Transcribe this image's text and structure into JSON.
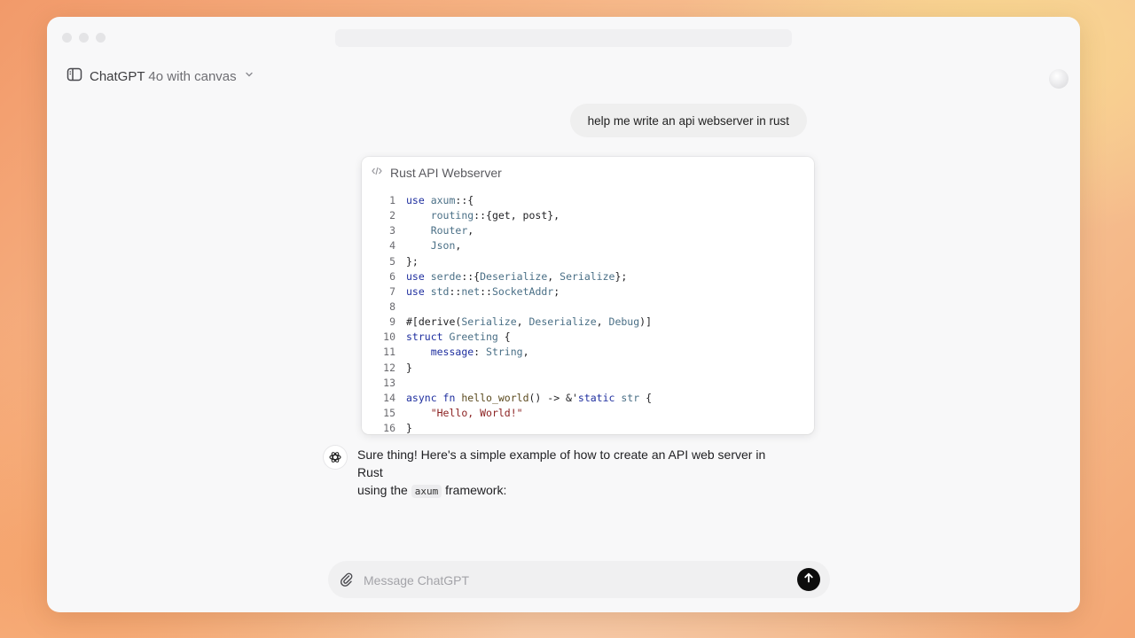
{
  "header": {
    "model_name": "ChatGPT",
    "model_variant": "4o with canvas"
  },
  "conversation": {
    "user_message": "help me write an api webserver in rust",
    "canvas": {
      "title": "Rust API Webserver",
      "line_numbers": [
        "1",
        "2",
        "3",
        "4",
        "5",
        "6",
        "7",
        "8",
        "9",
        "10",
        "11",
        "12",
        "13",
        "14",
        "15",
        "16"
      ],
      "lines": [
        [
          {
            "t": "use ",
            "c": "kw"
          },
          {
            "t": "axum",
            "c": "ty"
          },
          {
            "t": "::{",
            "c": "src"
          }
        ],
        [
          {
            "t": "    ",
            "c": "src"
          },
          {
            "t": "routing",
            "c": "ty"
          },
          {
            "t": "::{get, post},",
            "c": "src"
          }
        ],
        [
          {
            "t": "    ",
            "c": "src"
          },
          {
            "t": "Router",
            "c": "ty"
          },
          {
            "t": ",",
            "c": "src"
          }
        ],
        [
          {
            "t": "    ",
            "c": "src"
          },
          {
            "t": "Json",
            "c": "ty"
          },
          {
            "t": ",",
            "c": "src"
          }
        ],
        [
          {
            "t": "};",
            "c": "src"
          }
        ],
        [
          {
            "t": "use ",
            "c": "kw"
          },
          {
            "t": "serde",
            "c": "ty"
          },
          {
            "t": "::{",
            "c": "src"
          },
          {
            "t": "Deserialize",
            "c": "ty"
          },
          {
            "t": ", ",
            "c": "src"
          },
          {
            "t": "Serialize",
            "c": "ty"
          },
          {
            "t": "};",
            "c": "src"
          }
        ],
        [
          {
            "t": "use ",
            "c": "kw"
          },
          {
            "t": "std",
            "c": "ty"
          },
          {
            "t": "::",
            "c": "src"
          },
          {
            "t": "net",
            "c": "ty"
          },
          {
            "t": "::",
            "c": "src"
          },
          {
            "t": "SocketAddr",
            "c": "ty"
          },
          {
            "t": ";",
            "c": "src"
          }
        ],
        [
          {
            "t": "",
            "c": "src"
          }
        ],
        [
          {
            "t": "#[derive(",
            "c": "src"
          },
          {
            "t": "Serialize",
            "c": "ty"
          },
          {
            "t": ", ",
            "c": "src"
          },
          {
            "t": "Deserialize",
            "c": "ty"
          },
          {
            "t": ", ",
            "c": "src"
          },
          {
            "t": "Debug",
            "c": "ty"
          },
          {
            "t": ")]",
            "c": "src"
          }
        ],
        [
          {
            "t": "struct ",
            "c": "kw"
          },
          {
            "t": "Greeting",
            "c": "ty"
          },
          {
            "t": " {",
            "c": "src"
          }
        ],
        [
          {
            "t": "    ",
            "c": "src"
          },
          {
            "t": "message",
            "c": "kw"
          },
          {
            "t": ": ",
            "c": "src"
          },
          {
            "t": "String",
            "c": "ty"
          },
          {
            "t": ",",
            "c": "src"
          }
        ],
        [
          {
            "t": "}",
            "c": "src"
          }
        ],
        [
          {
            "t": "",
            "c": "src"
          }
        ],
        [
          {
            "t": "async ",
            "c": "kw"
          },
          {
            "t": "fn ",
            "c": "kw"
          },
          {
            "t": "hello_world",
            "c": "fnc"
          },
          {
            "t": "() -> &'",
            "c": "src"
          },
          {
            "t": "static ",
            "c": "kw"
          },
          {
            "t": "str",
            "c": "ty"
          },
          {
            "t": " {",
            "c": "src"
          }
        ],
        [
          {
            "t": "    ",
            "c": "src"
          },
          {
            "t": "\"Hello, World!\"",
            "c": "str"
          }
        ],
        [
          {
            "t": "}",
            "c": "src"
          }
        ]
      ]
    },
    "assistant_message": {
      "line1": "Sure thing! Here's a simple example of how to create an API web server in Rust",
      "line2_prefix": "using the ",
      "line2_code": "axum",
      "line2_suffix": " framework:"
    }
  },
  "composer": {
    "placeholder": "Message ChatGPT",
    "value": ""
  },
  "icons": {
    "sidebar_toggle": "sidebar-icon",
    "model_dropdown": "chevron-down-icon",
    "canvas_code": "code-icon",
    "assistant_logo": "openai-logo-icon",
    "attach": "paperclip-icon",
    "send": "arrow-up-icon"
  },
  "colors": {
    "send_button": "#0d0d0d",
    "keyword": "#1f2f9f",
    "type": "#4a6f86",
    "string": "#8a1f1f"
  }
}
